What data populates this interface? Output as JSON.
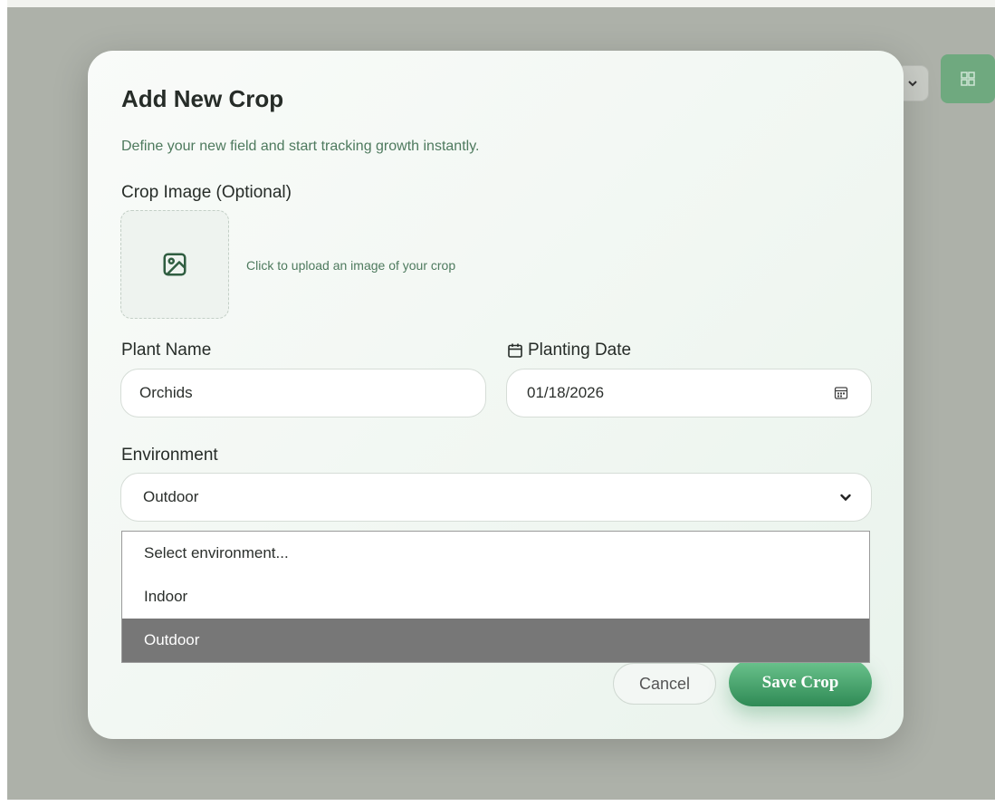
{
  "modal": {
    "title": "Add New Crop",
    "subtitle": "Define your new field and start tracking growth instantly.",
    "image_label": "Crop Image (Optional)",
    "upload_hint": "Click to upload an image of your crop",
    "plant_name_label": "Plant Name",
    "plant_name_value": "Orchids",
    "planting_date_label": "Planting Date",
    "planting_date_value": "01/18/2026",
    "environment_label": "Environment",
    "environment_value": "Outdoor",
    "environment_options": [
      "Select environment...",
      "Indoor",
      "Outdoor"
    ],
    "selected_option": "Outdoor",
    "cancel_label": "Cancel",
    "save_label": "Save Crop"
  },
  "colors": {
    "accent": "#3f9b65",
    "subtitle": "#4e7a5e",
    "highlight": "#777777"
  },
  "icons": {
    "upload": "image-icon",
    "date_label": "calendar-icon",
    "date_picker": "calendar-picker-icon",
    "select": "chevron-down-icon",
    "grid": "grid-icon"
  }
}
